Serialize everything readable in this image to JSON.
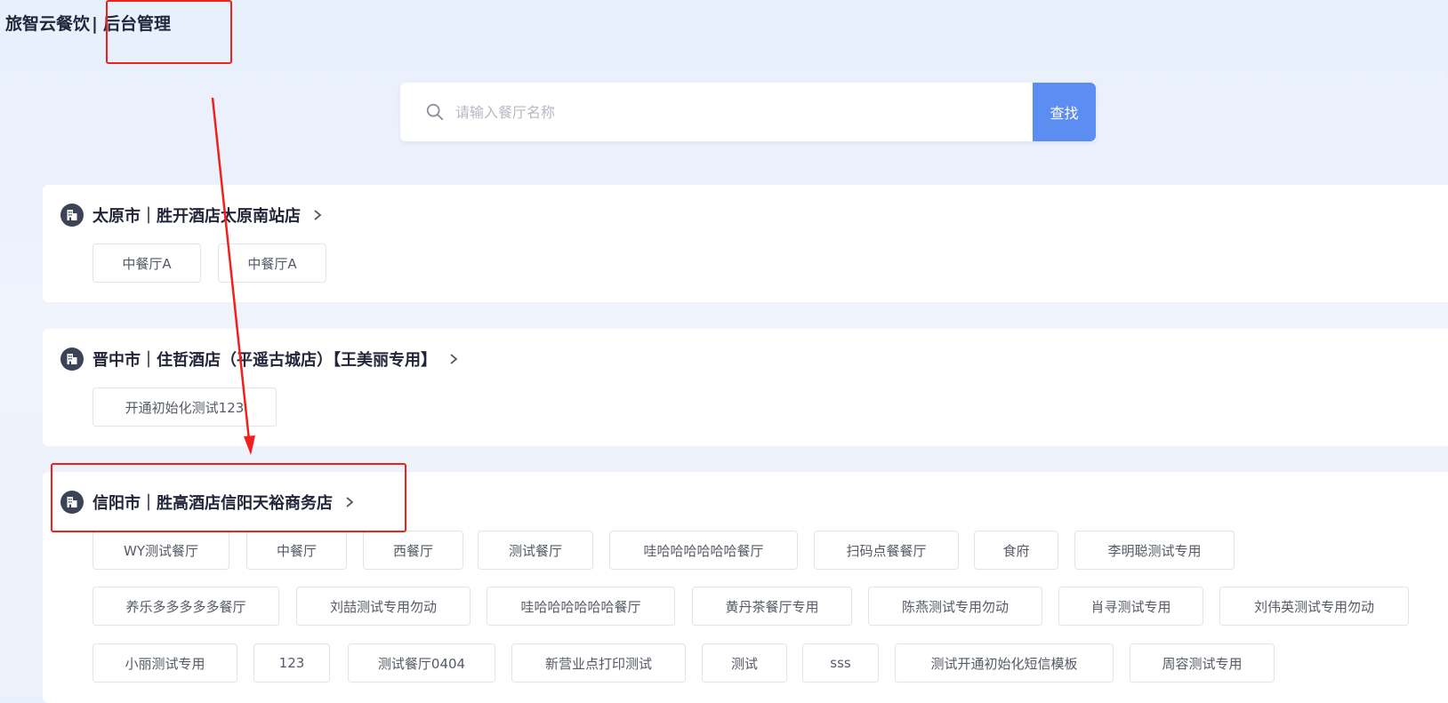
{
  "brand": {
    "name": "旅智云餐饮",
    "separator": "|",
    "section": "后台管理"
  },
  "search": {
    "placeholder": "请输入餐厅名称",
    "button_label": "查找"
  },
  "hotels": [
    {
      "name": "太原市｜胜开酒店太原南站店",
      "restaurants": [
        "中餐厅A",
        "中餐厅A"
      ]
    },
    {
      "name": "晋中市｜住哲酒店（平遥古城店）【王美丽专用】",
      "restaurants": [
        "开通初始化测试123"
      ]
    },
    {
      "name": "信阳市｜胜高酒店信阳天裕商务店",
      "restaurants": [
        "WY测试餐厅",
        "中餐厅",
        "西餐厅",
        "测试餐厅",
        "哇哈哈哈哈哈哈餐厅",
        "扫码点餐餐厅",
        "食府",
        "李明聪测试专用",
        "养乐多多多多多餐厅",
        "刘喆测试专用勿动",
        "哇哈哈哈哈哈哈餐厅",
        "黄丹茶餐厅专用",
        "陈燕测试专用勿动",
        "肖寻测试专用",
        "刘伟英测试专用勿动",
        "小丽测试专用",
        "123",
        "测试餐厅0404",
        "新营业点打印测试",
        "测试",
        "sss",
        "测试开通初始化短信模板",
        "周容测试专用"
      ]
    }
  ],
  "colors": {
    "accent": "#5b8ef0",
    "annotation": "#f0201c"
  }
}
